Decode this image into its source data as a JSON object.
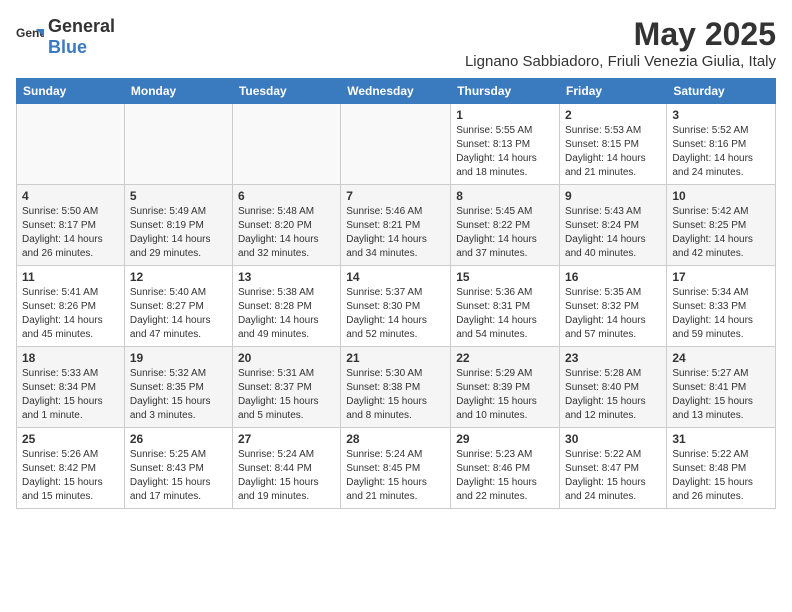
{
  "logo": {
    "general": "General",
    "blue": "Blue"
  },
  "title": "May 2025",
  "subtitle": "Lignano Sabbiadoro, Friuli Venezia Giulia, Italy",
  "days_of_week": [
    "Sunday",
    "Monday",
    "Tuesday",
    "Wednesday",
    "Thursday",
    "Friday",
    "Saturday"
  ],
  "weeks": [
    [
      {
        "day": null
      },
      {
        "day": null
      },
      {
        "day": null
      },
      {
        "day": null
      },
      {
        "day": "1",
        "sunrise": "5:55 AM",
        "sunset": "8:13 PM",
        "daylight": "14 hours and 18 minutes."
      },
      {
        "day": "2",
        "sunrise": "5:53 AM",
        "sunset": "8:15 PM",
        "daylight": "14 hours and 21 minutes."
      },
      {
        "day": "3",
        "sunrise": "5:52 AM",
        "sunset": "8:16 PM",
        "daylight": "14 hours and 24 minutes."
      }
    ],
    [
      {
        "day": "4",
        "sunrise": "5:50 AM",
        "sunset": "8:17 PM",
        "daylight": "14 hours and 26 minutes."
      },
      {
        "day": "5",
        "sunrise": "5:49 AM",
        "sunset": "8:19 PM",
        "daylight": "14 hours and 29 minutes."
      },
      {
        "day": "6",
        "sunrise": "5:48 AM",
        "sunset": "8:20 PM",
        "daylight": "14 hours and 32 minutes."
      },
      {
        "day": "7",
        "sunrise": "5:46 AM",
        "sunset": "8:21 PM",
        "daylight": "14 hours and 34 minutes."
      },
      {
        "day": "8",
        "sunrise": "5:45 AM",
        "sunset": "8:22 PM",
        "daylight": "14 hours and 37 minutes."
      },
      {
        "day": "9",
        "sunrise": "5:43 AM",
        "sunset": "8:24 PM",
        "daylight": "14 hours and 40 minutes."
      },
      {
        "day": "10",
        "sunrise": "5:42 AM",
        "sunset": "8:25 PM",
        "daylight": "14 hours and 42 minutes."
      }
    ],
    [
      {
        "day": "11",
        "sunrise": "5:41 AM",
        "sunset": "8:26 PM",
        "daylight": "14 hours and 45 minutes."
      },
      {
        "day": "12",
        "sunrise": "5:40 AM",
        "sunset": "8:27 PM",
        "daylight": "14 hours and 47 minutes."
      },
      {
        "day": "13",
        "sunrise": "5:38 AM",
        "sunset": "8:28 PM",
        "daylight": "14 hours and 49 minutes."
      },
      {
        "day": "14",
        "sunrise": "5:37 AM",
        "sunset": "8:30 PM",
        "daylight": "14 hours and 52 minutes."
      },
      {
        "day": "15",
        "sunrise": "5:36 AM",
        "sunset": "8:31 PM",
        "daylight": "14 hours and 54 minutes."
      },
      {
        "day": "16",
        "sunrise": "5:35 AM",
        "sunset": "8:32 PM",
        "daylight": "14 hours and 57 minutes."
      },
      {
        "day": "17",
        "sunrise": "5:34 AM",
        "sunset": "8:33 PM",
        "daylight": "14 hours and 59 minutes."
      }
    ],
    [
      {
        "day": "18",
        "sunrise": "5:33 AM",
        "sunset": "8:34 PM",
        "daylight": "15 hours and 1 minute."
      },
      {
        "day": "19",
        "sunrise": "5:32 AM",
        "sunset": "8:35 PM",
        "daylight": "15 hours and 3 minutes."
      },
      {
        "day": "20",
        "sunrise": "5:31 AM",
        "sunset": "8:37 PM",
        "daylight": "15 hours and 5 minutes."
      },
      {
        "day": "21",
        "sunrise": "5:30 AM",
        "sunset": "8:38 PM",
        "daylight": "15 hours and 8 minutes."
      },
      {
        "day": "22",
        "sunrise": "5:29 AM",
        "sunset": "8:39 PM",
        "daylight": "15 hours and 10 minutes."
      },
      {
        "day": "23",
        "sunrise": "5:28 AM",
        "sunset": "8:40 PM",
        "daylight": "15 hours and 12 minutes."
      },
      {
        "day": "24",
        "sunrise": "5:27 AM",
        "sunset": "8:41 PM",
        "daylight": "15 hours and 13 minutes."
      }
    ],
    [
      {
        "day": "25",
        "sunrise": "5:26 AM",
        "sunset": "8:42 PM",
        "daylight": "15 hours and 15 minutes."
      },
      {
        "day": "26",
        "sunrise": "5:25 AM",
        "sunset": "8:43 PM",
        "daylight": "15 hours and 17 minutes."
      },
      {
        "day": "27",
        "sunrise": "5:24 AM",
        "sunset": "8:44 PM",
        "daylight": "15 hours and 19 minutes."
      },
      {
        "day": "28",
        "sunrise": "5:24 AM",
        "sunset": "8:45 PM",
        "daylight": "15 hours and 21 minutes."
      },
      {
        "day": "29",
        "sunrise": "5:23 AM",
        "sunset": "8:46 PM",
        "daylight": "15 hours and 22 minutes."
      },
      {
        "day": "30",
        "sunrise": "5:22 AM",
        "sunset": "8:47 PM",
        "daylight": "15 hours and 24 minutes."
      },
      {
        "day": "31",
        "sunrise": "5:22 AM",
        "sunset": "8:48 PM",
        "daylight": "15 hours and 26 minutes."
      }
    ]
  ]
}
